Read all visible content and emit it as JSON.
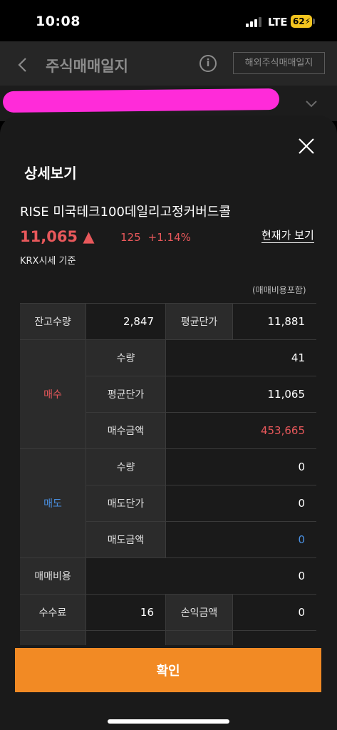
{
  "status": {
    "time": "10:08",
    "network": "LTE",
    "battery": "62"
  },
  "background": {
    "title": "주식매매일지",
    "info_icon": "i",
    "overseas_button": "해외주식매매일지"
  },
  "sheet": {
    "title": "상세보기",
    "stock_name": "RISE 미국테크100데일리고정커버드콜",
    "price": "11,065 ▲",
    "change": "125",
    "change_pct": "+1.14%",
    "current_price_link": "현재가 보기",
    "basis": "KRX시세 기준",
    "fee_note": "(매매비용포함)"
  },
  "table": {
    "holding_qty_label": "잔고수량",
    "holding_qty": "2,847",
    "avg_price_label": "평균단가",
    "avg_price": "11,881",
    "buy_label": "매수",
    "buy_qty_label": "수량",
    "buy_qty": "41",
    "buy_avg_label": "평균단가",
    "buy_avg": "11,065",
    "buy_amount_label": "매수금액",
    "buy_amount": "453,665",
    "sell_label": "매도",
    "sell_qty_label": "수량",
    "sell_qty": "0",
    "sell_price_label": "매도단가",
    "sell_price": "0",
    "sell_amount_label": "매도금액",
    "sell_amount": "0",
    "trade_cost_label": "매매비용",
    "trade_cost": "0",
    "commission_label": "수수료",
    "commission": "16",
    "pnl_label": "손익금액",
    "pnl": "0"
  },
  "confirm_label": "확인",
  "colors": {
    "up": "#e8585b",
    "down": "#4a90e2",
    "accent": "#f28a24"
  }
}
